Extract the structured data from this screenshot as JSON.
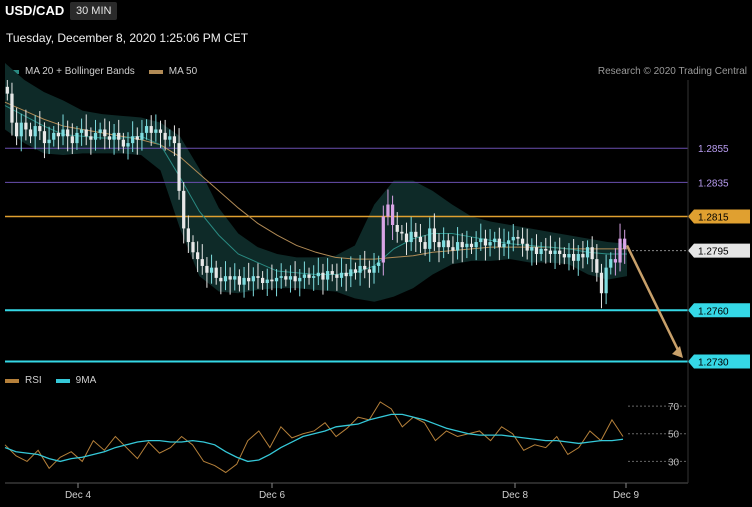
{
  "header": {
    "symbol": "USD/CAD",
    "timeframe": "30 MIN",
    "datetime": "Tuesday, December 8, 2020 1:25:06 PM CET"
  },
  "legend": {
    "bb_label": "MA 20 + Bollinger Bands",
    "ma50_label": "MA 50",
    "rsi_label": "RSI",
    "ma9_label": "9MA"
  },
  "credit": "Research © 2020 Trading Central",
  "colors": {
    "background": "#000000",
    "bollinger_fill": "#0e2a28",
    "ma20": "#2a8a82",
    "ma50": "#b08a55",
    "candle_up": "#7fdde0",
    "candle_down": "#e8e8e8",
    "candle_pink": "#d9a4e6",
    "resistance_purple": "#6a4fb0",
    "pivot_orange": "#e0a030",
    "support_cyan": "#35d8e6",
    "arrow": "#c8a06a",
    "rsi": "#b5803a",
    "rsi_ma9": "#35c8d8"
  },
  "chart_data": [
    {
      "type": "candlestick",
      "title": "USD/CAD",
      "x_tick_labels": [
        "Dec 4",
        "Dec 6",
        "Dec 8",
        "Dec 9"
      ],
      "ylim": [
        1.2725,
        1.2895
      ],
      "levels": [
        {
          "value": 1.2855,
          "label": "1.2855",
          "style": "resistance"
        },
        {
          "value": 1.2835,
          "label": "1.2835",
          "style": "resistance"
        },
        {
          "value": 1.2815,
          "label": "1.2815",
          "style": "pivot"
        },
        {
          "value": 1.2795,
          "label": "1.2795",
          "style": "last"
        },
        {
          "value": 1.276,
          "label": "1.2760",
          "style": "support"
        },
        {
          "value": 1.273,
          "label": "1.2730",
          "style": "support"
        }
      ],
      "close_series": [
        1.2887,
        1.287,
        1.2862,
        1.287,
        1.2866,
        1.2862,
        1.2868,
        1.2865,
        1.2858,
        1.286,
        1.2864,
        1.2862,
        1.2866,
        1.2862,
        1.2858,
        1.2864,
        1.2866,
        1.2862,
        1.286,
        1.2864,
        1.2866,
        1.2862,
        1.286,
        1.2864,
        1.286,
        1.2856,
        1.2858,
        1.2862,
        1.286,
        1.2864,
        1.2868,
        1.2864,
        1.2866,
        1.2864,
        1.286,
        1.2862,
        1.2858,
        1.283,
        1.2808,
        1.28,
        1.2794,
        1.279,
        1.2786,
        1.2782,
        1.2785,
        1.2779,
        1.2777,
        1.278,
        1.2778,
        1.278,
        1.2775,
        1.2779,
        1.2777,
        1.278,
        1.2779,
        1.2776,
        1.2778,
        1.2777,
        1.2779,
        1.278,
        1.2778,
        1.278,
        1.2777,
        1.2779,
        1.2781,
        1.2779,
        1.278,
        1.2782,
        1.2778,
        1.2783,
        1.2781,
        1.2779,
        1.2782,
        1.278,
        1.2784,
        1.2782,
        1.2786,
        1.2784,
        1.2782,
        1.2786,
        1.2788,
        1.2815,
        1.2822,
        1.281,
        1.2806,
        1.2805,
        1.28,
        1.2806,
        1.2803,
        1.28,
        1.2796,
        1.2808,
        1.28,
        1.2797,
        1.2801,
        1.2797,
        1.2795,
        1.28,
        1.2797,
        1.2799,
        1.2797,
        1.28,
        1.2802,
        1.2798,
        1.28,
        1.2802,
        1.2797,
        1.2799,
        1.2801,
        1.2803,
        1.2802,
        1.2799,
        1.2795,
        1.2797,
        1.2793,
        1.2796,
        1.2795,
        1.2793,
        1.2795,
        1.2793,
        1.2791,
        1.2793,
        1.2789,
        1.2793,
        1.2791,
        1.2797,
        1.279,
        1.2782,
        1.277,
        1.2785,
        1.279,
        1.2788,
        1.2802,
        1.2796
      ],
      "ma20": [
        1.288,
        1.2874,
        1.2868,
        1.2863,
        1.2862,
        1.2861,
        1.2861,
        1.2862,
        1.2857,
        1.2838,
        1.2818,
        1.2804,
        1.2793,
        1.2788,
        1.2783,
        1.2782,
        1.2781,
        1.2781,
        1.2782,
        1.2786,
        1.2796,
        1.2802,
        1.2805,
        1.2805,
        1.2803,
        1.2801,
        1.2799,
        1.2798,
        1.2797,
        1.2796,
        1.2794,
        1.2793,
        1.2793
      ],
      "ma50": [
        1.2882,
        1.2877,
        1.2872,
        1.2868,
        1.2866,
        1.2864,
        1.2862,
        1.286,
        1.2857,
        1.285,
        1.284,
        1.283,
        1.282,
        1.2811,
        1.2804,
        1.2798,
        1.2794,
        1.2791,
        1.279,
        1.279,
        1.2791,
        1.2792,
        1.2794,
        1.2795,
        1.2796,
        1.2797,
        1.2797,
        1.2797,
        1.2797,
        1.2796,
        1.2796,
        1.2796,
        1.2796
      ],
      "bb_upper": [
        1.2905,
        1.2895,
        1.2888,
        1.2883,
        1.2877,
        1.2875,
        1.2874,
        1.2873,
        1.287,
        1.2862,
        1.2843,
        1.282,
        1.2805,
        1.2797,
        1.2793,
        1.2791,
        1.2791,
        1.2792,
        1.2798,
        1.2822,
        1.2836,
        1.2836,
        1.283,
        1.2822,
        1.2815,
        1.2812,
        1.281,
        1.2808,
        1.2806,
        1.2804,
        1.2802,
        1.28,
        1.2799
      ],
      "bb_lower": [
        1.2866,
        1.2858,
        1.2852,
        1.2851,
        1.2852,
        1.2852,
        1.2852,
        1.2851,
        1.2842,
        1.2808,
        1.278,
        1.2771,
        1.277,
        1.2772,
        1.2773,
        1.2773,
        1.2772,
        1.2771,
        1.2767,
        1.2765,
        1.2768,
        1.2773,
        1.2781,
        1.2787,
        1.2789,
        1.2789,
        1.279,
        1.2788,
        1.2788,
        1.2787,
        1.2781,
        1.2778,
        1.278
      ]
    },
    {
      "type": "line",
      "title": "RSI",
      "ylim": [
        18,
        78
      ],
      "y_tick_labels": [
        "70",
        "50",
        "30"
      ],
      "y_ticks": [
        70,
        50,
        30
      ],
      "series": [
        {
          "name": "RSI",
          "values": [
            42,
            34,
            30,
            38,
            25,
            33,
            37,
            30,
            45,
            38,
            48,
            40,
            32,
            44,
            36,
            40,
            48,
            42,
            30,
            27,
            22,
            28,
            45,
            52,
            40,
            55,
            47,
            50,
            52,
            58,
            48,
            54,
            62,
            60,
            73,
            68,
            55,
            62,
            58,
            45,
            52,
            48,
            50,
            52,
            45,
            55,
            50,
            38,
            42,
            40,
            48,
            35,
            40,
            52,
            45,
            60,
            48
          ]
        },
        {
          "name": "9MA",
          "values": [
            40,
            37,
            36,
            35,
            32,
            30,
            32,
            33,
            35,
            37,
            40,
            42,
            44,
            45,
            45,
            44,
            44,
            45,
            44,
            42,
            37,
            33,
            30,
            31,
            35,
            40,
            44,
            48,
            50,
            52,
            55,
            56,
            57,
            60,
            62,
            64,
            64,
            62,
            60,
            57,
            54,
            52,
            50,
            49,
            49,
            49,
            48,
            47,
            46,
            45,
            45,
            44,
            43,
            44,
            45,
            45,
            46
          ]
        }
      ]
    }
  ]
}
